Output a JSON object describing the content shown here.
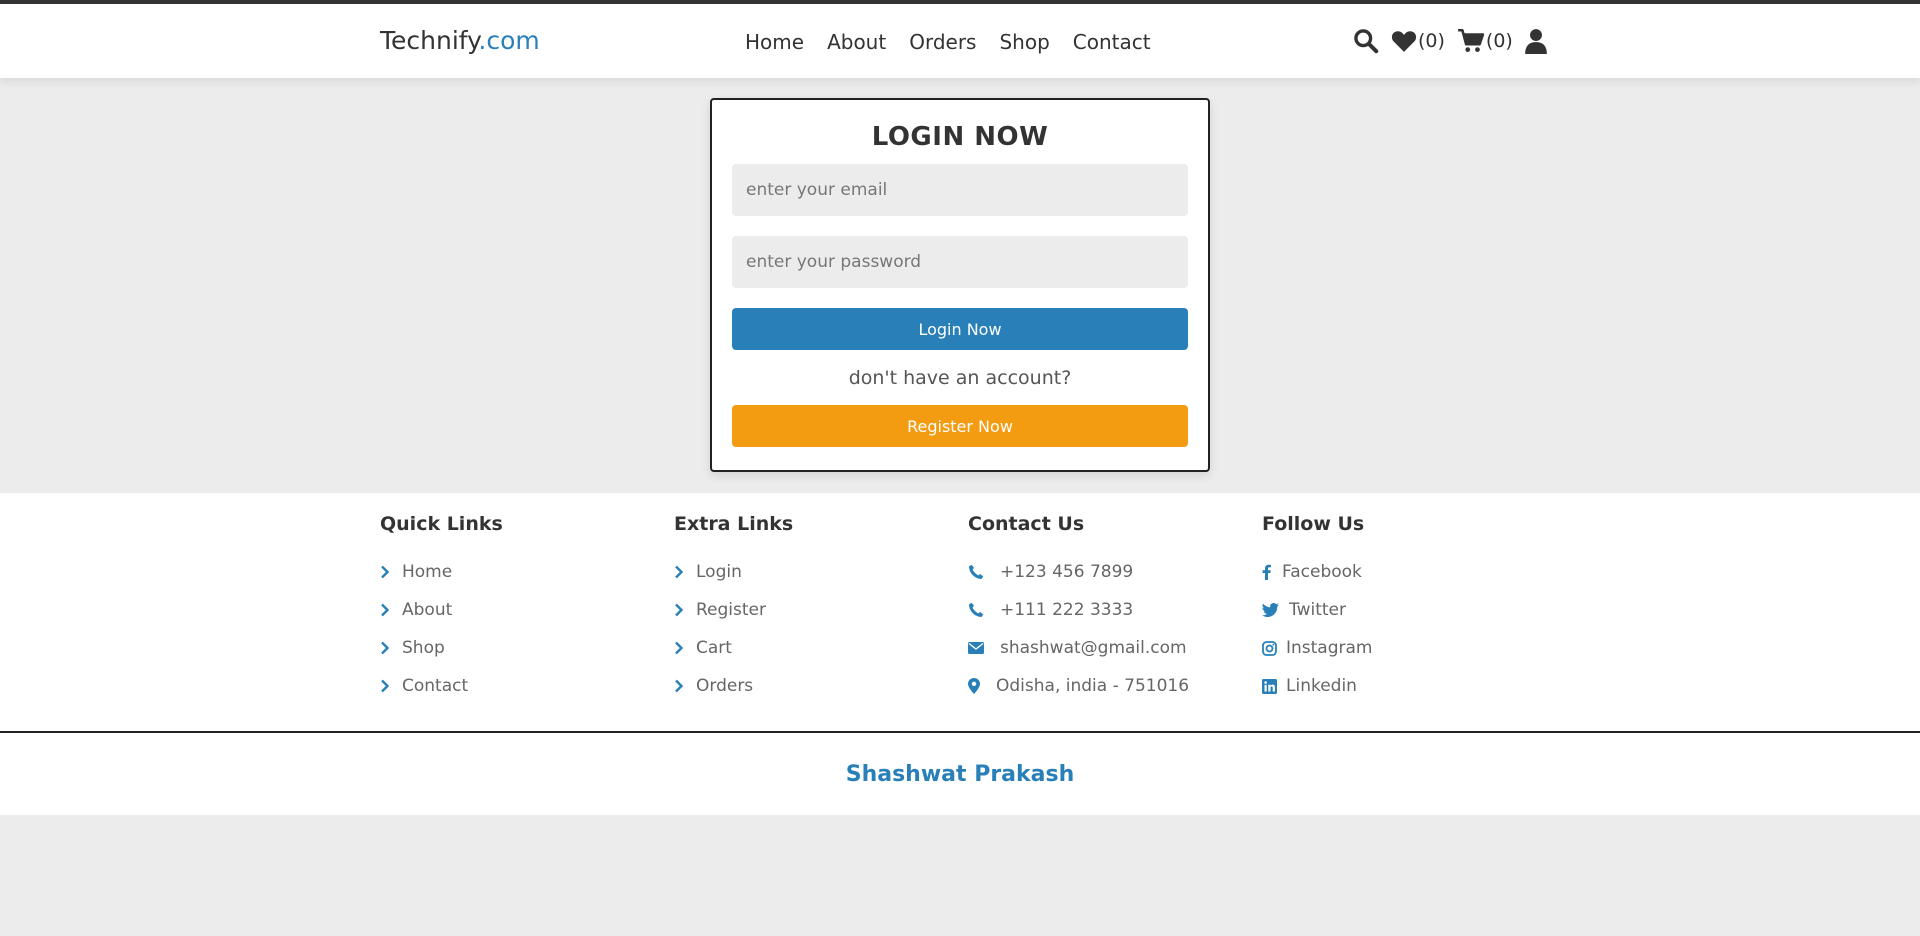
{
  "header": {
    "logo_main": "Technify",
    "logo_accent": ".com",
    "nav": [
      "Home",
      "About",
      "Orders",
      "Shop",
      "Contact"
    ],
    "wishlist_count": "(0)",
    "cart_count": "(0)"
  },
  "login": {
    "title": "LOGIN NOW",
    "email_placeholder": "enter your email",
    "password_placeholder": "enter your password",
    "login_button": "Login Now",
    "note": "don't have an account?",
    "register_button": "Register Now"
  },
  "footer": {
    "quick_links": {
      "title": "Quick Links",
      "items": [
        "Home",
        "About",
        "Shop",
        "Contact"
      ]
    },
    "extra_links": {
      "title": "Extra Links",
      "items": [
        "Login",
        "Register",
        "Cart",
        "Orders"
      ]
    },
    "contact": {
      "title": "Contact Us",
      "items": [
        "+123 456 7899",
        "+111 222 3333",
        "shashwat@gmail.com",
        "Odisha, india - 751016"
      ]
    },
    "follow": {
      "title": "Follow Us",
      "items": [
        "Facebook",
        "Twitter",
        "Instagram",
        "Linkedin"
      ]
    },
    "credit": "Shashwat Prakash"
  },
  "colors": {
    "accent": "#2980b9",
    "orange": "#f39c12",
    "background": "#ececec"
  },
  "icons": [
    "search-icon",
    "heart-icon",
    "cart-icon",
    "user-icon",
    "chevron-right-icon",
    "phone-icon",
    "envelope-icon",
    "map-marker-icon",
    "facebook-icon",
    "twitter-icon",
    "instagram-icon",
    "linkedin-icon"
  ]
}
